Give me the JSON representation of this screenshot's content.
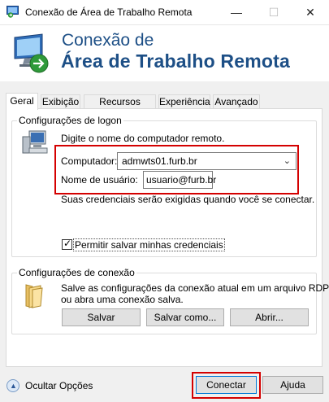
{
  "window": {
    "title": "Conexão de Área de Trabalho Remota",
    "minimize": "—",
    "maximize": "☐",
    "close": "✕"
  },
  "banner": {
    "line1": "Conexão de",
    "line2": "Área de Trabalho Remota"
  },
  "tabs": [
    {
      "label": "Geral"
    },
    {
      "label": "Exibição"
    },
    {
      "label": "Recursos Locais"
    },
    {
      "label": "Experiência"
    },
    {
      "label": "Avançado"
    }
  ],
  "logon": {
    "legend": "Configurações de logon",
    "prompt": "Digite o nome do computador remoto.",
    "computer_label": "Computador:",
    "computer_value": "admwts01.furb.br",
    "username_label": "Nome de usuário:",
    "username_value": "usuario@furb.br",
    "credentials_note": "Suas credenciais serão exigidas quando você se conectar.",
    "save_credentials_label": "Permitir salvar minhas credenciais",
    "save_credentials_checked": true
  },
  "connection": {
    "legend": "Configurações de conexão",
    "desc_line1": "Salve as configurações da conexão atual em um arquivo RDP",
    "desc_line2": "ou abra uma conexão salva.",
    "save_label": "Salvar",
    "save_as_label": "Salvar como...",
    "open_label": "Abrir..."
  },
  "footer": {
    "hide_options_label": "Ocultar Opções",
    "connect_label": "Conectar",
    "help_label": "Ajuda"
  },
  "colors": {
    "banner_text": "#1d4f86",
    "highlight": "#d40000",
    "primary_border": "#0078d7"
  },
  "icons": {
    "app": "remote-desktop-icon",
    "computer": "computer-icon",
    "folder": "folder-icon",
    "expand": "chevron-up-icon"
  }
}
